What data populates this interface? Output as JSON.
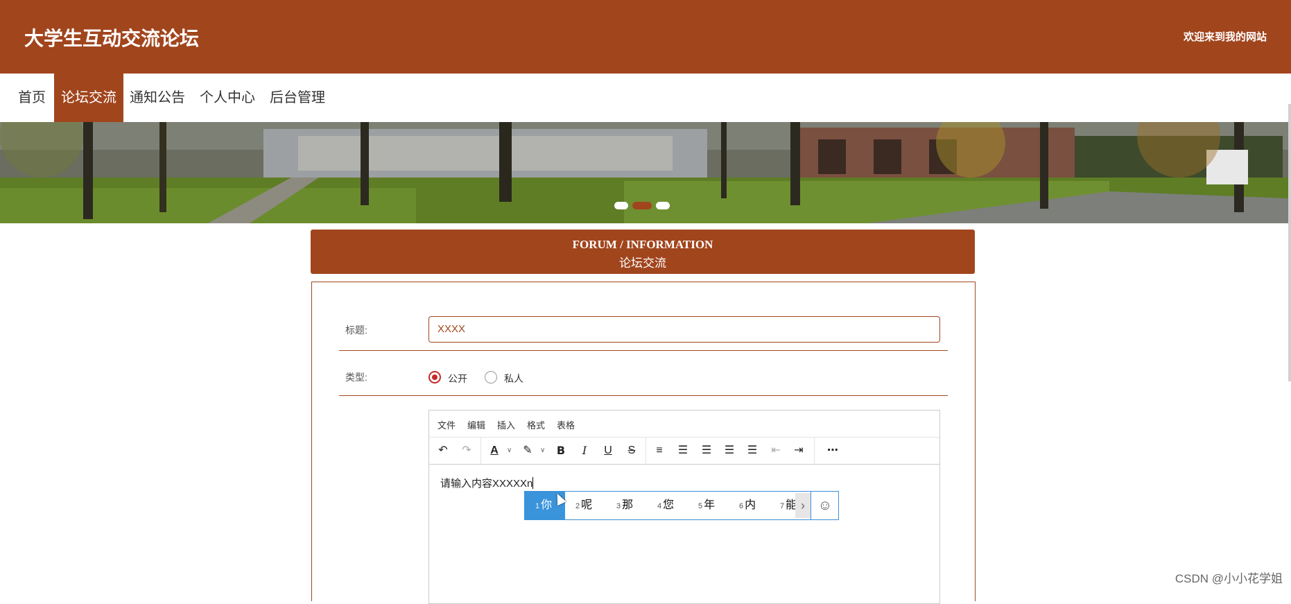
{
  "header": {
    "site_title": "大学生互动交流论坛",
    "welcome": "欢迎来到我的网站",
    "brand_color": "#a1451d"
  },
  "nav": {
    "items": [
      {
        "label": "首页",
        "active": false
      },
      {
        "label": "论坛交流",
        "active": true
      },
      {
        "label": "通知公告",
        "active": false
      },
      {
        "label": "个人中心",
        "active": false
      },
      {
        "label": "后台管理",
        "active": false
      }
    ]
  },
  "banner": {
    "slide_count": 3,
    "active_slide": 2
  },
  "section": {
    "title_en": "FORUM / INFORMATION",
    "title_cn": "论坛交流"
  },
  "form": {
    "title_label": "标题:",
    "title_value": "XXXX",
    "type_label": "类型:",
    "type_options": [
      {
        "label": "公开",
        "checked": true
      },
      {
        "label": "私人",
        "checked": false
      }
    ]
  },
  "editor": {
    "menus": [
      "文件",
      "编辑",
      "插入",
      "格式",
      "表格"
    ],
    "toolbar_icons": [
      "undo-icon",
      "redo-icon",
      "text-color-icon",
      "highlight-icon",
      "bold-icon",
      "italic-icon",
      "underline-icon",
      "strikethrough-icon",
      "numbered-list-icon",
      "align-left-icon",
      "align-center-icon",
      "align-right-icon",
      "justify-icon",
      "outdent-icon",
      "indent-icon",
      "more-icon"
    ],
    "content": "请输入内容XXXXXn"
  },
  "ime": {
    "candidates": [
      {
        "num": "1",
        "text": "你"
      },
      {
        "num": "2",
        "text": "呢"
      },
      {
        "num": "3",
        "text": "那"
      },
      {
        "num": "4",
        "text": "您"
      },
      {
        "num": "5",
        "text": "年"
      },
      {
        "num": "6",
        "text": "内"
      },
      {
        "num": "7",
        "text": "能"
      }
    ]
  },
  "watermark": "CSDN @小小花学姐"
}
